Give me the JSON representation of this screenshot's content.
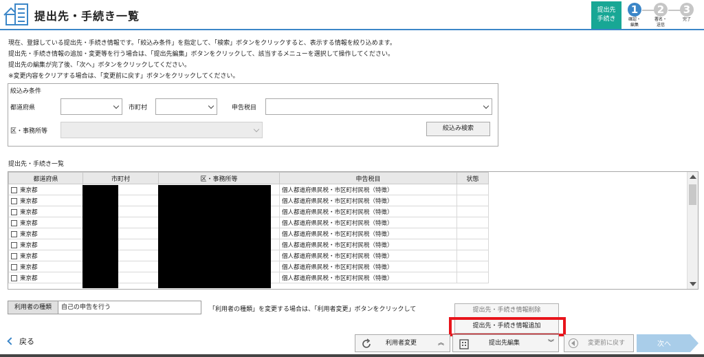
{
  "header": {
    "title": "提出先・手続き一覧"
  },
  "steps": {
    "box_label_1": "提出先",
    "box_label_2": "手続き",
    "items": [
      {
        "number": "1",
        "label_1": "確認・",
        "label_2": "編集",
        "color": "#3b86c8"
      },
      {
        "number": "2",
        "label_1": "署名・",
        "label_2": "送信",
        "color": "#c6c6c6"
      },
      {
        "number": "3",
        "label_1": "完了",
        "label_2": "",
        "color": "#c6c6c6"
      }
    ]
  },
  "instructions": [
    "現在、登録している提出先・手続き情報です。「絞込み条件」を指定して、「検索」ボタンをクリックすると、表示する情報を絞り込めます。",
    "提出先・手続き情報の追加・変更等を行う場合は、「提出先編集」ボタンをクリックして、該当するメニューを選択して操作してください。",
    "提出先の編集が完了後、「次へ」ボタンをクリックしてください。",
    "※変更内容をクリアする場合は、「変更前に戻す」ボタンをクリックしてください。"
  ],
  "filter": {
    "title": "絞込み条件",
    "prefecture_label": "都道府県",
    "city_label": "市町村",
    "tax_label": "申告税目",
    "office_label": "区・事務所等",
    "search_button": "絞込み検索"
  },
  "list": {
    "title": "提出先・手続き一覧",
    "columns": [
      "都道府県",
      "市町村",
      "区・事務所等",
      "申告税目",
      "状態"
    ],
    "rows": [
      {
        "prefecture": "東京都",
        "tax": "個人都道府県民税・市区町村民税（特徴）"
      },
      {
        "prefecture": "東京都",
        "tax": "個人都道府県民税・市区町村民税（特徴）"
      },
      {
        "prefecture": "東京都",
        "tax": "個人都道府県民税・市区町村民税（特徴）"
      },
      {
        "prefecture": "東京都",
        "tax": "個人都道府県民税・市区町村民税（特徴）"
      },
      {
        "prefecture": "東京都",
        "tax": "個人都道府県民税・市区町村民税（特徴）"
      },
      {
        "prefecture": "東京都",
        "tax": "個人都道府県民税・市区町村民税（特徴）"
      },
      {
        "prefecture": "東京都",
        "tax": "個人都道府県民税・市区町村民税（特徴）"
      },
      {
        "prefecture": "東京都",
        "tax": "個人都道府県民税・市区町村民税（特徴）"
      },
      {
        "prefecture": "東京都",
        "tax": "個人都道府県民税・市区町村民税（特徴）"
      }
    ]
  },
  "user_type": {
    "label": "利用者の種類",
    "value": "自己の申告を行う",
    "note": "「利用者の種類」を変更する場合は、「利用者変更」ボタンをクリックして"
  },
  "edit_menu": {
    "delete_item": "提出先・手続き情報削除",
    "add_item": "提出先・手続き情報追加"
  },
  "footer": {
    "back_label": "戻る",
    "change_user_label": "利用者変更",
    "edit_destination_label": "提出先編集",
    "revert_label": "変更前に戻す",
    "next_label": "次へ"
  },
  "colors": {
    "accent": "#3b86c8",
    "step_box": "#18a795",
    "highlight": "#e8141b",
    "next_button": "#a9cde9"
  }
}
